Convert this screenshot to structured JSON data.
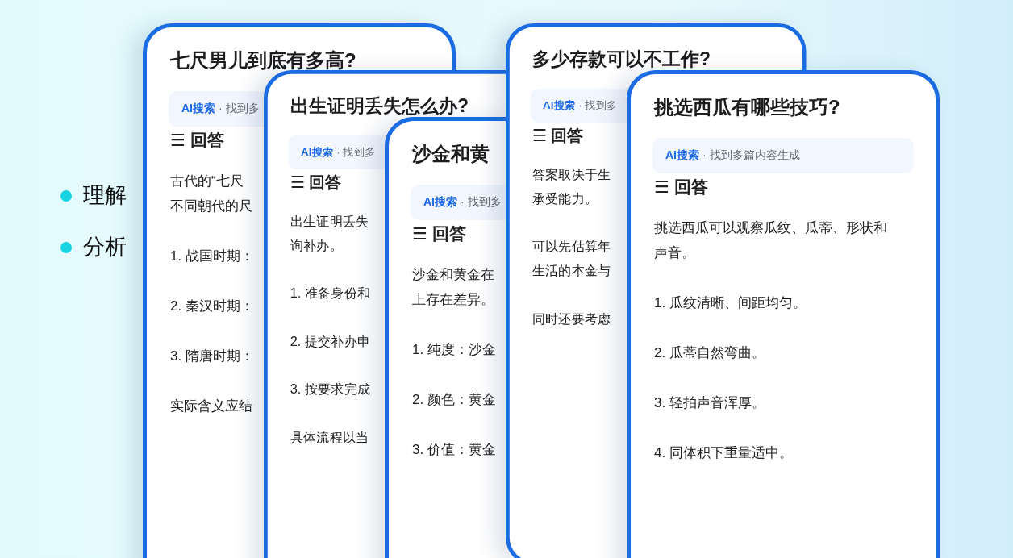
{
  "bullets": [
    "理解",
    "分析"
  ],
  "cards": [
    {
      "title": "七尺男儿到底有多高?",
      "source": "AI搜索",
      "source_note": "· 找到多",
      "heading": "☰ 回答",
      "paragraphs": [
        [
          "古代的“七尺",
          "不同朝代的尺"
        ],
        [
          "1. 战国时期："
        ],
        [
          "2. 秦汉时期："
        ],
        [
          "3. 隋唐时期："
        ],
        [
          "实际含义应结"
        ]
      ]
    },
    {
      "title": "出生证明丢失怎么办?",
      "source": "AI搜索",
      "source_note": "· 找到多",
      "heading": "☰ 回答",
      "paragraphs": [
        [
          "出生证明丢失",
          "询补办。"
        ],
        [
          "1. 准备身份和"
        ],
        [
          "2. 提交补办申"
        ],
        [
          "3. 按要求完成"
        ],
        [
          "具体流程以当"
        ]
      ]
    },
    {
      "title": "沙金和黄",
      "source": "AI搜索",
      "source_note": "· 找到多",
      "heading": "☰ 回答",
      "paragraphs": [
        [
          "沙金和黄金在",
          "上存在差异。"
        ],
        [
          "1. 纯度：沙金"
        ],
        [
          "2. 颜色：黄金"
        ],
        [
          "3. 价值：黄金"
        ]
      ]
    },
    {
      "title": "多少存款可以不工作?",
      "source": "AI搜索",
      "source_note": "· 找到多",
      "heading": "☰ 回答",
      "paragraphs": [
        [
          "答案取决于生",
          "承受能力。"
        ],
        [
          "可以先估算年",
          "生活的本金与"
        ],
        [
          "同时还要考虑"
        ]
      ]
    },
    {
      "title": "挑选西瓜有哪些技巧?",
      "source": "AI搜索",
      "source_note": "· 找到多篇内容生成",
      "heading": "☰ 回答",
      "paragraphs": [
        [
          "挑选西瓜可以观察瓜纹、瓜蒂、形状和",
          "声音。"
        ],
        [
          "1. 瓜纹清晰、间距均匀。"
        ],
        [
          "2. 瓜蒂自然弯曲。"
        ],
        [
          "3. 轻拍声音浑厚。"
        ],
        [
          "4. 同体积下重量适中。"
        ]
      ]
    }
  ]
}
